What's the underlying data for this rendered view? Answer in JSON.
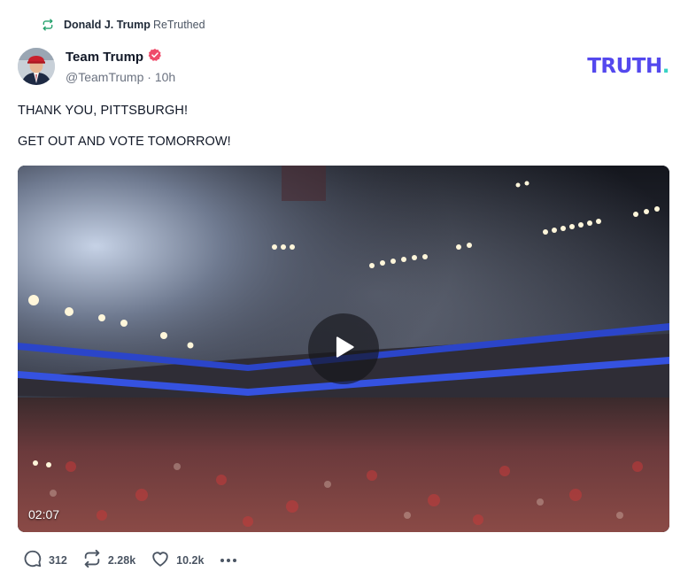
{
  "retruth": {
    "user": "Donald J. Trump",
    "verb": "ReTruthed"
  },
  "post": {
    "author_name": "Team Trump",
    "handle": "@TeamTrump",
    "separator": " · ",
    "time": "10h",
    "lines": [
      "THANK YOU, PITTSBURGH!",
      "GET OUT AND VOTE TOMORROW!"
    ],
    "media": {
      "duration": "02:07"
    }
  },
  "brand": {
    "word": "TRUTH",
    "dot": ".",
    "color": "#5448ee",
    "dot_color": "#38d3c4"
  },
  "actions": {
    "replies": "312",
    "retruths": "2.28k",
    "likes": "10.2k"
  },
  "icons": [
    "retruth-icon",
    "verified-badge-icon",
    "play-icon",
    "reply-icon",
    "like-icon",
    "more-icon"
  ],
  "colors": {
    "retruth_green": "#22a06b",
    "verified_pink": "#ef4b6a",
    "muted": "#6b7280"
  }
}
